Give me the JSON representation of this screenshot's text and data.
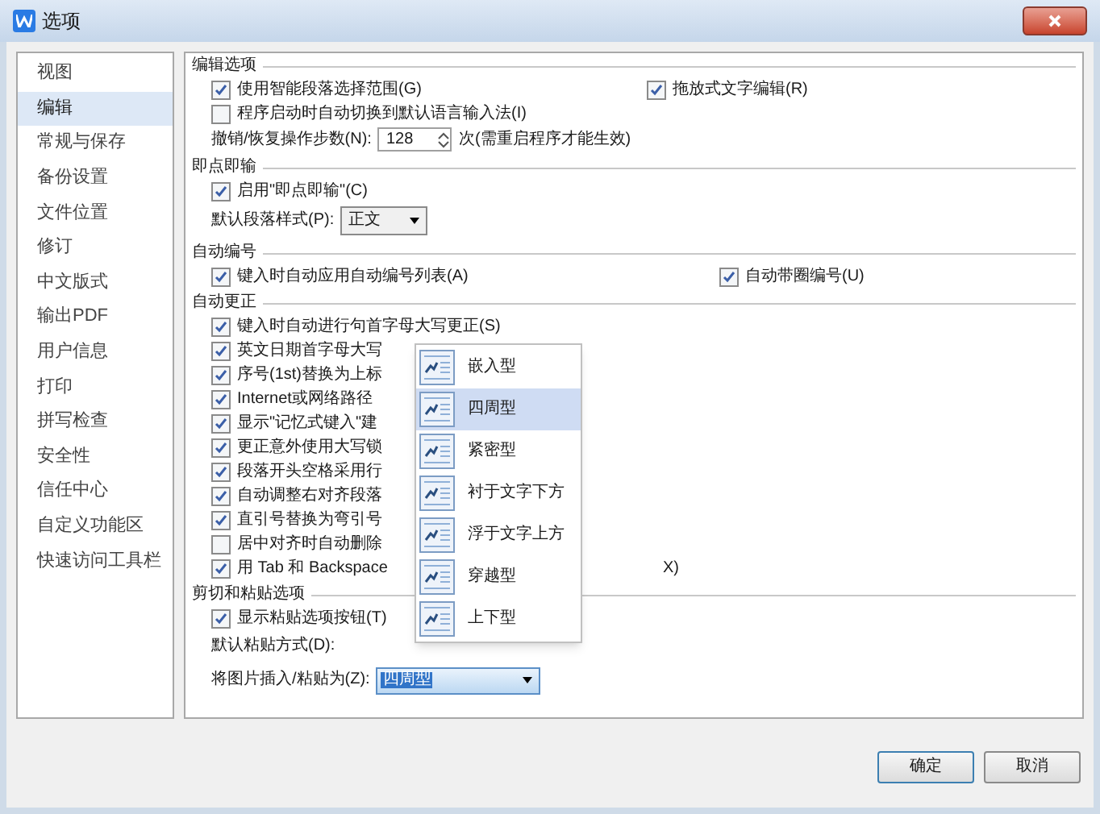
{
  "window": {
    "title": "选项"
  },
  "sidebar": {
    "items": [
      {
        "label": "视图",
        "selected": false
      },
      {
        "label": "编辑",
        "selected": true
      },
      {
        "label": "常规与保存",
        "selected": false
      },
      {
        "label": "备份设置",
        "selected": false
      },
      {
        "label": "文件位置",
        "selected": false
      },
      {
        "label": "修订",
        "selected": false
      },
      {
        "label": "中文版式",
        "selected": false
      },
      {
        "label": "输出PDF",
        "selected": false
      },
      {
        "label": "用户信息",
        "selected": false
      },
      {
        "label": "打印",
        "selected": false
      },
      {
        "label": "拼写检查",
        "selected": false
      },
      {
        "label": "安全性",
        "selected": false
      },
      {
        "label": "信任中心",
        "selected": false
      },
      {
        "label": "自定义功能区",
        "selected": false
      },
      {
        "label": "快速访问工具栏",
        "selected": false
      }
    ]
  },
  "sections": [
    {
      "title": "编辑选项",
      "rows": [
        {
          "kind": "checkbox",
          "label": "使用智能段落选择范围(G)",
          "checked": true,
          "right": {
            "label": "拖放式文字编辑(R)",
            "checked": true
          }
        },
        {
          "kind": "checkbox",
          "label": "程序启动时自动切换到默认语言输入法(I)",
          "checked": false
        },
        {
          "kind": "spinner",
          "label": "撤销/恢复操作步数(N):",
          "value": "128",
          "note": "次(需重启程序才能生效)"
        }
      ]
    },
    {
      "title": "即点即输",
      "rows": [
        {
          "kind": "checkbox",
          "label": "启用\"即点即输\"(C)",
          "checked": true
        },
        {
          "kind": "select",
          "label": "默认段落样式(P):",
          "value": "正文"
        }
      ]
    },
    {
      "title": "自动编号",
      "rows": [
        {
          "kind": "checkbox",
          "label": "键入时自动应用自动编号列表(A)",
          "checked": true,
          "right": {
            "label": "自动带圈编号(U)",
            "checked": true
          }
        }
      ]
    },
    {
      "title": "自动更正",
      "rows": [
        {
          "kind": "checkbox",
          "label": "键入时自动进行句首字母大写更正(S)",
          "checked": true
        },
        {
          "kind": "checkbox",
          "label": "英文日期首字母大写",
          "checked": true
        },
        {
          "kind": "checkbox",
          "label": "序号(1st)替换为上标",
          "checked": true
        },
        {
          "kind": "checkbox",
          "label": "Internet或网络路径",
          "checked": true
        },
        {
          "kind": "checkbox",
          "label": "显示\"记忆式键入\"建",
          "checked": true
        },
        {
          "kind": "checkbox",
          "label": "更正意外使用大写锁",
          "checked": true
        },
        {
          "kind": "checkbox",
          "label": "段落开头空格采用行",
          "checked": true
        },
        {
          "kind": "checkbox",
          "label": "自动调整右对齐段落",
          "checked": true
        },
        {
          "kind": "checkbox",
          "label": "直引号替换为弯引号",
          "checked": true
        },
        {
          "kind": "checkbox",
          "label": "居中对齐时自动删除",
          "checked": false
        },
        {
          "kind": "checkbox",
          "label": "用 Tab 和 Backspace",
          "checked": true,
          "tail": "X)"
        }
      ]
    },
    {
      "title": "剪切和粘贴选项",
      "rows": [
        {
          "kind": "checkbox",
          "label": "显示粘贴选项按钮(T)",
          "checked": true
        },
        {
          "kind": "label",
          "label": "默认粘贴方式(D):"
        },
        {
          "kind": "picker",
          "label": "将图片插入/粘贴为(Z):",
          "value": "四周型"
        }
      ]
    }
  ],
  "wrap_menu": {
    "items": [
      {
        "label": "嵌入型",
        "selected": false
      },
      {
        "label": "四周型",
        "selected": true
      },
      {
        "label": "紧密型",
        "selected": false
      },
      {
        "label": "衬于文字下方",
        "selected": false
      },
      {
        "label": "浮于文字上方",
        "selected": false
      },
      {
        "label": "穿越型",
        "selected": false
      },
      {
        "label": "上下型",
        "selected": false
      }
    ]
  },
  "buttons": [
    "确定",
    "取消"
  ]
}
